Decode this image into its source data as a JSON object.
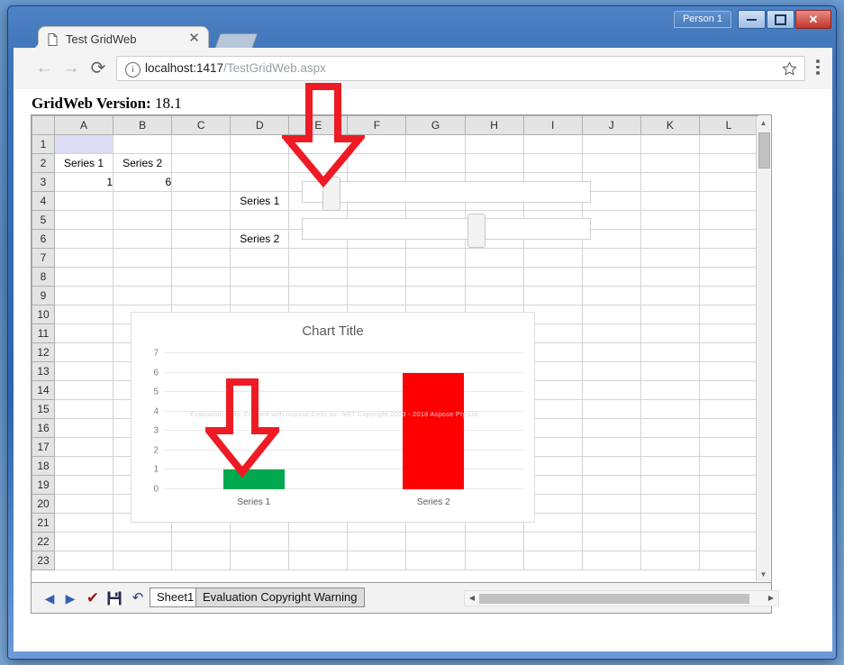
{
  "window": {
    "person_button": "Person 1",
    "minimize": "—",
    "maximize": "□",
    "close": "✕"
  },
  "browser": {
    "tab_title": "Test GridWeb",
    "tab_close": "✕",
    "back_icon": "←",
    "forward_icon": "→",
    "reload_icon": "⟳",
    "info_icon": "i",
    "url_prefix": "localhost:1417",
    "url_suffix": "/TestGridWeb.aspx",
    "url_full": "localhost:1417/TestGridWeb.aspx",
    "star_icon": "☆",
    "menu_icon": "⋮"
  },
  "page": {
    "version_label": "GridWeb Version:",
    "version_value": "18.1"
  },
  "grid": {
    "columns": [
      "A",
      "B",
      "C",
      "D",
      "E",
      "F",
      "G",
      "H",
      "I",
      "J",
      "K",
      "L"
    ],
    "rows": [
      "1",
      "2",
      "3",
      "4",
      "5",
      "6",
      "7",
      "8",
      "9",
      "10",
      "11",
      "12",
      "13",
      "14",
      "15",
      "16",
      "17",
      "18",
      "19",
      "20",
      "21",
      "22",
      "23"
    ],
    "selected_cell": "A1",
    "cells": {
      "A2": "Series 1",
      "B2": "Series 2",
      "A3": "1",
      "B3": "6",
      "D4": "Series 1",
      "D6": "Series 2"
    }
  },
  "sliders": [
    {
      "label": "Series 1",
      "value_position_pct": 7
    },
    {
      "label": "Series 2",
      "value_position_pct": 57
    }
  ],
  "chart_data": {
    "type": "bar",
    "title": "Chart Title",
    "categories": [
      "Series 1",
      "Series 2"
    ],
    "values": [
      1,
      6
    ],
    "colors": [
      "#00a94f",
      "#ff0000"
    ],
    "xlabel": "",
    "ylabel": "",
    "ylim": [
      0,
      7
    ],
    "yticks": [
      0,
      1,
      2,
      3,
      4,
      5,
      6,
      7
    ],
    "grid": true,
    "legend": false,
    "watermark": "Evaluation Only. Created with Aspose.Cells for .NET Copyright 2003 - 2018 Aspose Pty Ltd."
  },
  "sheetbar": {
    "prev_icon": "◀",
    "next_icon": "▶",
    "submit_icon": "✔",
    "save_icon": "💾",
    "undo_icon": "↶",
    "tabs": [
      {
        "label": "Sheet1",
        "active": true
      },
      {
        "label": "Evaluation Copyright Warning",
        "active": false
      }
    ]
  },
  "scrollbars": {
    "v_up": "▲",
    "v_down": "▼",
    "h_left": "◀",
    "h_right": "▶"
  },
  "annotations": {
    "arrow_color": "#ee1b24",
    "arrow_top_target": "series-1-slider",
    "arrow_chart_target": "series-1-bar"
  }
}
